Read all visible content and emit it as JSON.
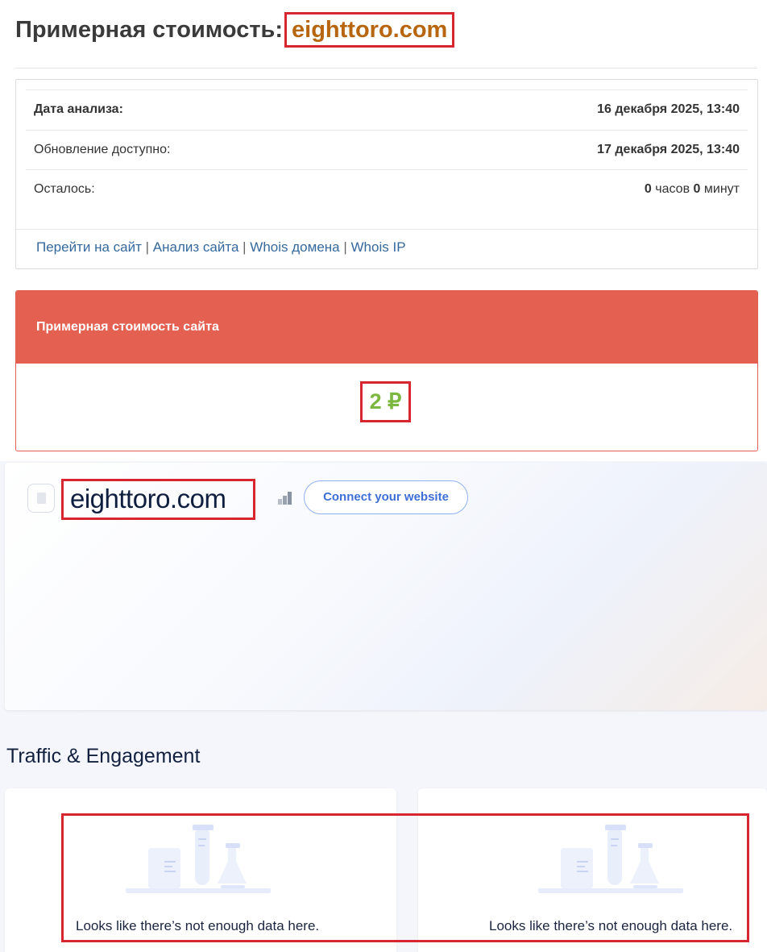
{
  "header": {
    "title_prefix": "Примерная стоимость:",
    "domain": "eighttoro.com"
  },
  "info": {
    "rows": [
      {
        "label": "Дата анализа:",
        "value": "16 декабря 2025, 13:40"
      },
      {
        "label": "Обновление доступно:",
        "value": "17 декабря 2025, 13:40"
      },
      {
        "label": "Осталось:",
        "hours": "0",
        "hours_unit": "часов",
        "minutes": "0",
        "minutes_unit": "минут"
      }
    ],
    "links": [
      "Перейти на сайт",
      "Анализ сайта",
      "Whois домена",
      "Whois IP"
    ],
    "separator": "|"
  },
  "valuation": {
    "title": "Примерная стоимость сайта",
    "price": "2 ₽",
    "price_color": "#7cb83f",
    "header_color": "#e46051"
  },
  "site_panel": {
    "site_name": "eighttoro.com",
    "connect_button": "Connect your website"
  },
  "traffic": {
    "section_title": "Traffic & Engagement",
    "panels": [
      {
        "empty_message": "Looks like there’s not enough data here."
      },
      {
        "empty_message": "Looks like there’s not enough data here."
      }
    ]
  },
  "icons": [
    "document-icon",
    "rank-bars-icon",
    "lab-flask-illustration"
  ]
}
